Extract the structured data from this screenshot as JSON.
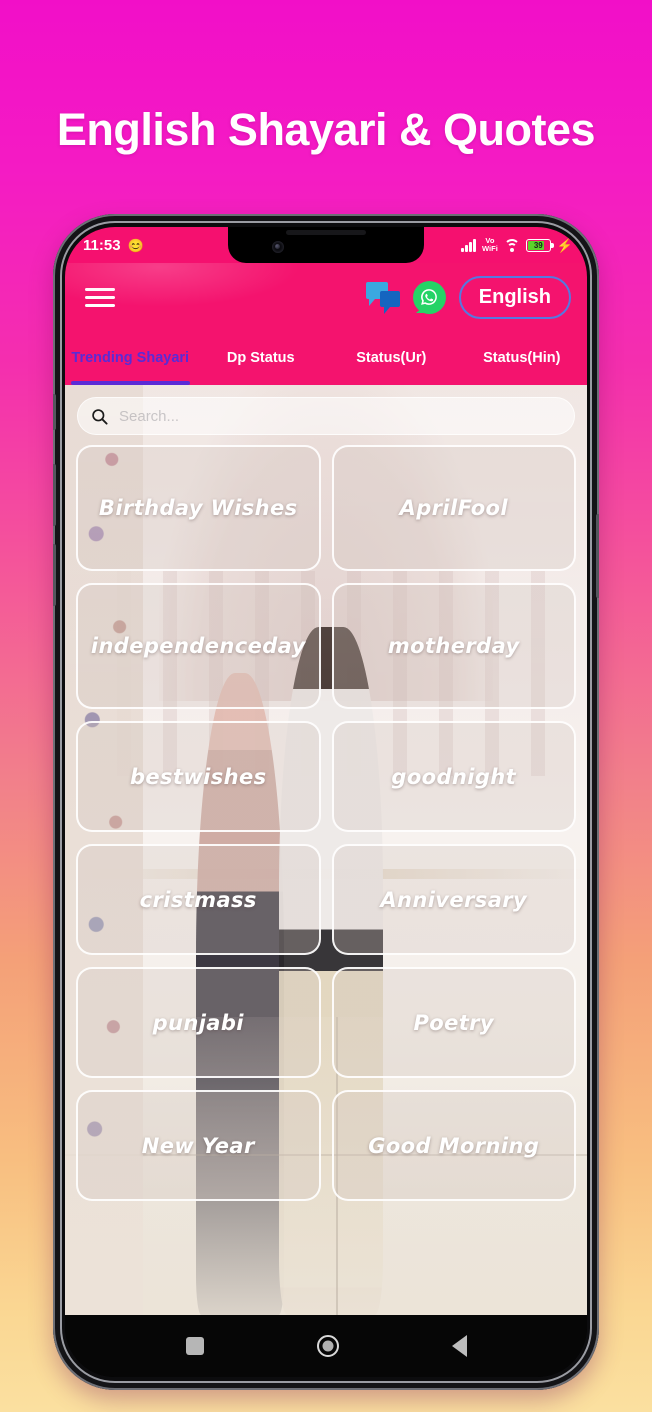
{
  "promo": {
    "headline": "English Shayari & Quotes",
    "bg_top_color": "#F20FC8",
    "bg_bottom_color": "#FBE0A0"
  },
  "status_bar": {
    "time": "11:53",
    "emoji_icon": "smiley-icon",
    "signal_icon": "cellular-signal-icon",
    "vowifi_line1": "Vo",
    "vowifi_line2": "WiFi",
    "wifi_icon": "wifi-icon",
    "battery_percent": "39",
    "charging_icon": "charging-bolt-icon",
    "bg_color": "#F5106F"
  },
  "app_bar": {
    "menu_icon": "hamburger-menu-icon",
    "chat_icon": "chat-bubbles-icon",
    "whatsapp_icon": "whatsapp-icon",
    "language_label": "English",
    "language_border_color": "#5579E0",
    "bg_color": "#F4136E"
  },
  "tabs": {
    "active_index": 0,
    "active_color": "#5A2BD6",
    "items": [
      {
        "label": "Trending Shayari"
      },
      {
        "label": "Dp Status"
      },
      {
        "label": "Status(Ur)"
      },
      {
        "label": "Status(Hin)"
      }
    ]
  },
  "search": {
    "icon": "search-icon",
    "value": "",
    "placeholder": "Search..."
  },
  "grid": {
    "cards": [
      {
        "label": "Birthday Wishes"
      },
      {
        "label": "AprilFool"
      },
      {
        "label": "independenceday"
      },
      {
        "label": "motherday"
      },
      {
        "label": "bestwishes"
      },
      {
        "label": "goodnight"
      },
      {
        "label": "cristmass"
      },
      {
        "label": "Anniversary"
      },
      {
        "label": "punjabi"
      },
      {
        "label": "Poetry"
      },
      {
        "label": "New Year"
      },
      {
        "label": "Good Morning"
      }
    ]
  },
  "nav_bar": {
    "recents_icon": "recents-square-icon",
    "home_icon": "home-circle-icon",
    "back_icon": "back-triangle-icon"
  }
}
